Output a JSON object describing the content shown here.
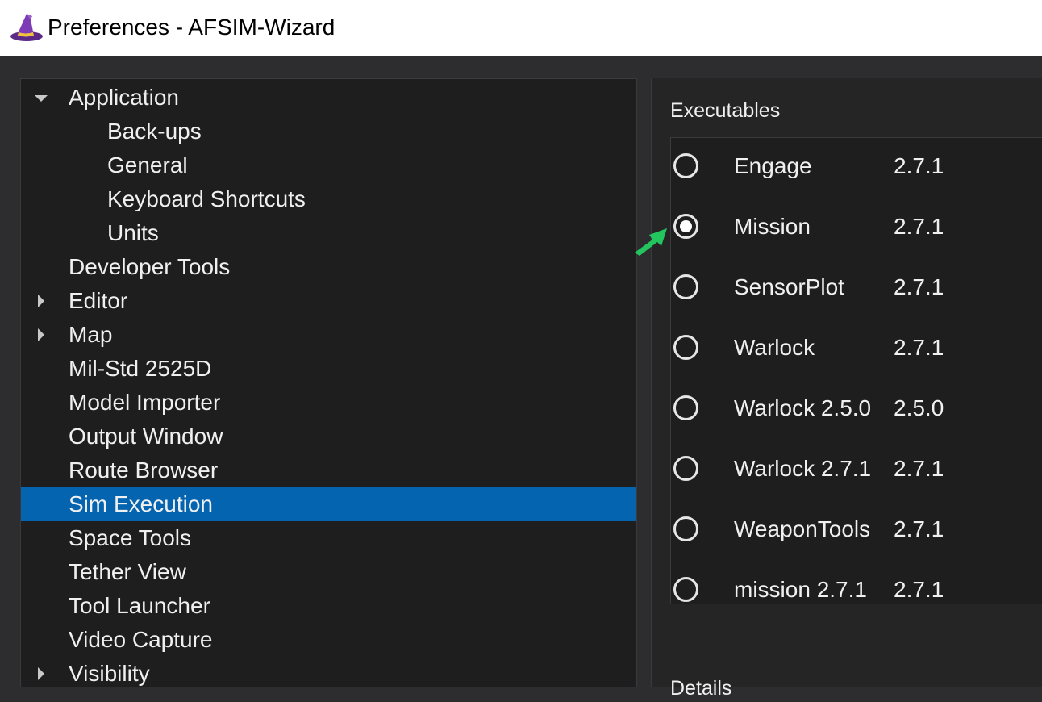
{
  "window": {
    "title": "Preferences - AFSIM-Wizard"
  },
  "colors": {
    "selection": "#0564b0",
    "arrow_annotation": "#22c55e",
    "background": "#1e1e1e"
  },
  "tree": {
    "items": [
      {
        "label": "Application",
        "expander": "expanded"
      },
      {
        "label": "Back-ups",
        "indent": 1
      },
      {
        "label": "General",
        "indent": 1
      },
      {
        "label": "Keyboard Shortcuts",
        "indent": 1
      },
      {
        "label": "Units",
        "indent": 1
      },
      {
        "label": "Developer Tools"
      },
      {
        "label": "Editor",
        "expander": "collapsed"
      },
      {
        "label": "Map",
        "expander": "collapsed"
      },
      {
        "label": "Mil-Std 2525D"
      },
      {
        "label": "Model Importer"
      },
      {
        "label": "Output Window"
      },
      {
        "label": "Route Browser"
      },
      {
        "label": "Sim Execution",
        "selected": true
      },
      {
        "label": "Space Tools"
      },
      {
        "label": "Tether View"
      },
      {
        "label": "Tool Launcher"
      },
      {
        "label": "Video Capture"
      },
      {
        "label": "Visibility",
        "expander": "collapsed"
      }
    ]
  },
  "executables": {
    "title": "Executables",
    "items": [
      {
        "name": "Engage",
        "version": "2.7.1",
        "checked": false
      },
      {
        "name": "Mission",
        "version": "2.7.1",
        "checked": true
      },
      {
        "name": "SensorPlot",
        "version": "2.7.1",
        "checked": false
      },
      {
        "name": "Warlock",
        "version": "2.7.1",
        "checked": false
      },
      {
        "name": "Warlock 2.5.0",
        "version": "2.5.0",
        "checked": false
      },
      {
        "name": "Warlock 2.7.1",
        "version": "2.7.1",
        "checked": false
      },
      {
        "name": "WeaponTools",
        "version": "2.7.1",
        "checked": false
      },
      {
        "name": "mission 2.7.1",
        "version": "2.7.1",
        "checked": false
      }
    ]
  },
  "details": {
    "title": "Details"
  }
}
